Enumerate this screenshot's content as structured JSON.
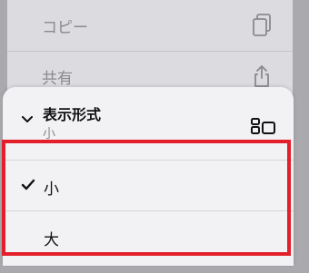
{
  "back_menu": {
    "items": [
      {
        "label": "コピー",
        "icon": "copy-icon"
      },
      {
        "label": "共有",
        "icon": "share-icon"
      }
    ]
  },
  "view_submenu": {
    "title": "表示形式",
    "current_value": "小",
    "header_icon": "layout-icon",
    "options": [
      {
        "label": "小",
        "selected": true
      },
      {
        "label": "大",
        "selected": false
      }
    ]
  },
  "colors": {
    "highlight": "#e21f2b",
    "background": "#a9a9ae"
  }
}
